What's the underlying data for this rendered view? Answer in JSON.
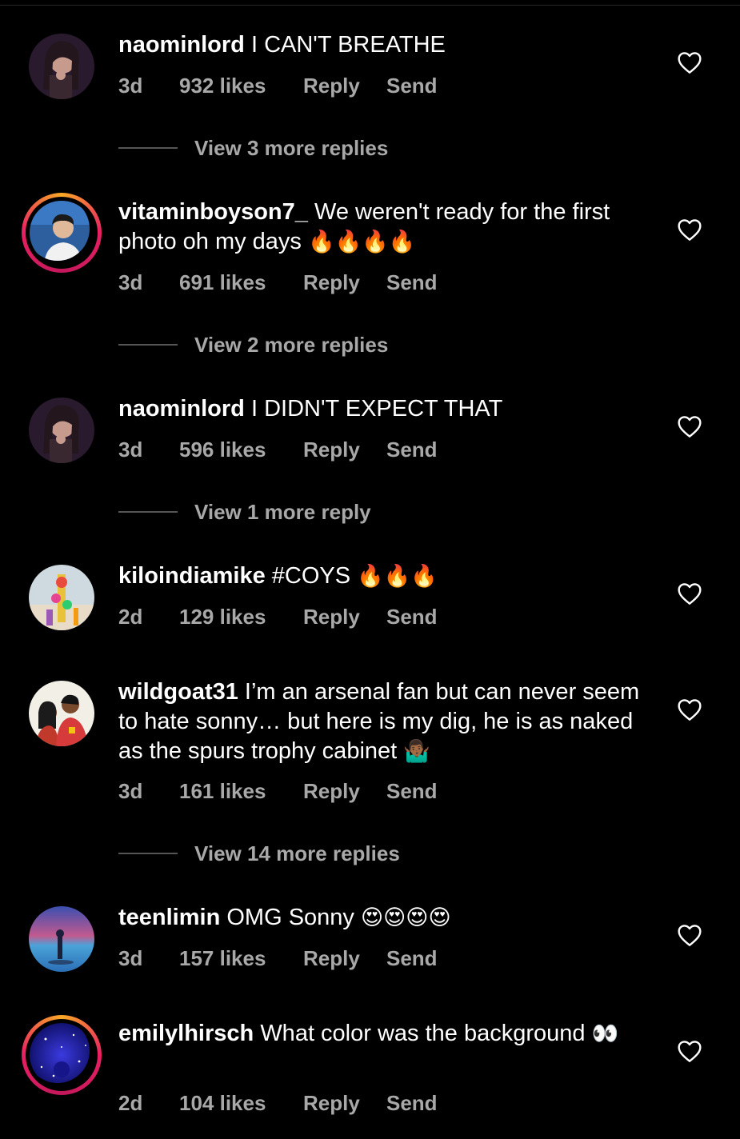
{
  "comments": [
    {
      "username": "naominlord",
      "text": "I CAN'T BREATHE",
      "emoji": "",
      "time": "3d",
      "likes": "932 likes",
      "reply": "Reply",
      "send": "Send",
      "view_replies": "View 3 more replies",
      "avatar_ring": false
    },
    {
      "username": "vitaminboyson7_",
      "text": "We weren't ready for the first photo oh my days",
      "emoji": "🔥🔥🔥🔥",
      "time": "3d",
      "likes": "691 likes",
      "reply": "Reply",
      "send": "Send",
      "view_replies": "View 2 more replies",
      "avatar_ring": true
    },
    {
      "username": "naominlord",
      "text": "I DIDN'T EXPECT THAT",
      "emoji": "",
      "time": "3d",
      "likes": "596 likes",
      "reply": "Reply",
      "send": "Send",
      "view_replies": "View 1 more reply",
      "avatar_ring": false
    },
    {
      "username": "kiloindiamike",
      "text": "#COYS",
      "emoji": "🔥🔥🔥",
      "time": "2d",
      "likes": "129 likes",
      "reply": "Reply",
      "send": "Send",
      "view_replies": "",
      "avatar_ring": false
    },
    {
      "username": "wildgoat31",
      "text": "I’m an arsenal fan but can never seem to hate sonny… but here is my dig, he is as naked as the spurs trophy cabinet",
      "emoji": "🤷🏾‍♂️",
      "time": "3d",
      "likes": "161 likes",
      "reply": "Reply",
      "send": "Send",
      "view_replies": "View 14 more replies",
      "avatar_ring": false
    },
    {
      "username": "teenlimin",
      "text": "OMG Sonny",
      "emoji": "😍😍😍😍",
      "time": "3d",
      "likes": "157 likes",
      "reply": "Reply",
      "send": "Send",
      "view_replies": "",
      "avatar_ring": false
    },
    {
      "username": "emilylhirsch",
      "text": "What color was the background",
      "emoji": "👀",
      "time": "2d",
      "likes": "104 likes",
      "reply": "Reply",
      "send": "Send",
      "view_replies": "",
      "avatar_ring": true
    }
  ],
  "icons": {
    "like": "heart-outline-icon"
  },
  "colors": {
    "background": "#000000",
    "text": "#ffffff",
    "secondary": "#a8a8a8"
  }
}
